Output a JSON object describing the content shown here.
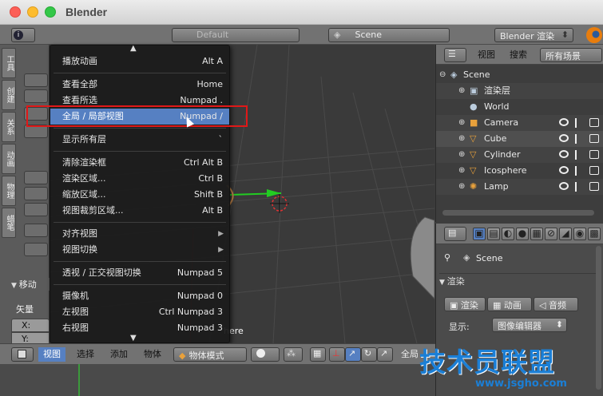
{
  "window": {
    "title": "Blender"
  },
  "topbar": {
    "layout_name": "Default",
    "scene_name": "Scene",
    "render_engine": "Blender 渲染"
  },
  "left_panel": {
    "tabs": [
      "工具",
      "创建",
      "关系",
      "动画",
      "物理",
      "蜡笔"
    ]
  },
  "view_menu": {
    "items": [
      {
        "label": "播放动画",
        "shortcut": "Alt A"
      },
      {
        "sep": true
      },
      {
        "label": "查看全部",
        "shortcut": "Home"
      },
      {
        "label": "查看所选",
        "shortcut": "Numpad ."
      },
      {
        "label": "全局 / 局部视图",
        "shortcut": "Numpad /",
        "selected": true
      },
      {
        "sep": true
      },
      {
        "label": "显示所有层",
        "shortcut": "`"
      },
      {
        "sep": true
      },
      {
        "label": "清除渲染框",
        "shortcut": "Ctrl Alt B"
      },
      {
        "label": "渲染区域...",
        "shortcut": "Ctrl B"
      },
      {
        "label": "缩放区域...",
        "shortcut": "Shift B"
      },
      {
        "label": "视图裁剪区域...",
        "shortcut": "Alt B"
      },
      {
        "sep": true
      },
      {
        "label": "对齐视图",
        "shortcut": "",
        "submenu": true
      },
      {
        "label": "视图切换",
        "shortcut": "",
        "submenu": true
      },
      {
        "sep": true
      },
      {
        "label": "透视 / 正交视图切换",
        "shortcut": "Numpad 5"
      },
      {
        "sep": true
      },
      {
        "label": "摄像机",
        "shortcut": "Numpad 0"
      },
      {
        "label": "左视图",
        "shortcut": "Ctrl Numpad 3"
      },
      {
        "label": "右视图",
        "shortcut": "Numpad 3"
      }
    ]
  },
  "left_partial": {
    "move_label": "移动",
    "vector_label": "矢量",
    "x_label": "X:",
    "y_label": "Y:"
  },
  "viewport_overlay_text": "here",
  "bottombar": {
    "menus": [
      "视图",
      "选择",
      "添加",
      "物体"
    ],
    "mode": "物体模式",
    "global": "全局"
  },
  "outliner": {
    "header": {
      "view": "视图",
      "search": "搜索",
      "filter": "所有场景"
    },
    "rows": [
      {
        "label": "Scene",
        "indent": 0
      },
      {
        "label": "渲染层",
        "indent": 1
      },
      {
        "label": "World",
        "indent": 1
      },
      {
        "label": "Camera",
        "indent": 1
      },
      {
        "label": "Cube",
        "indent": 1
      },
      {
        "label": "Cylinder",
        "indent": 1
      },
      {
        "label": "Icosphere",
        "indent": 1
      },
      {
        "label": "Lamp",
        "indent": 1
      }
    ]
  },
  "properties": {
    "scene_label": "Scene",
    "render_panel": "渲染",
    "render_btn": "渲染",
    "anim_btn": "动画",
    "audio_btn": "音频",
    "display_label": "显示:",
    "display_value": "图像编辑器"
  },
  "watermark": {
    "text": "技术员联盟",
    "url": "www.jsgho.com"
  }
}
